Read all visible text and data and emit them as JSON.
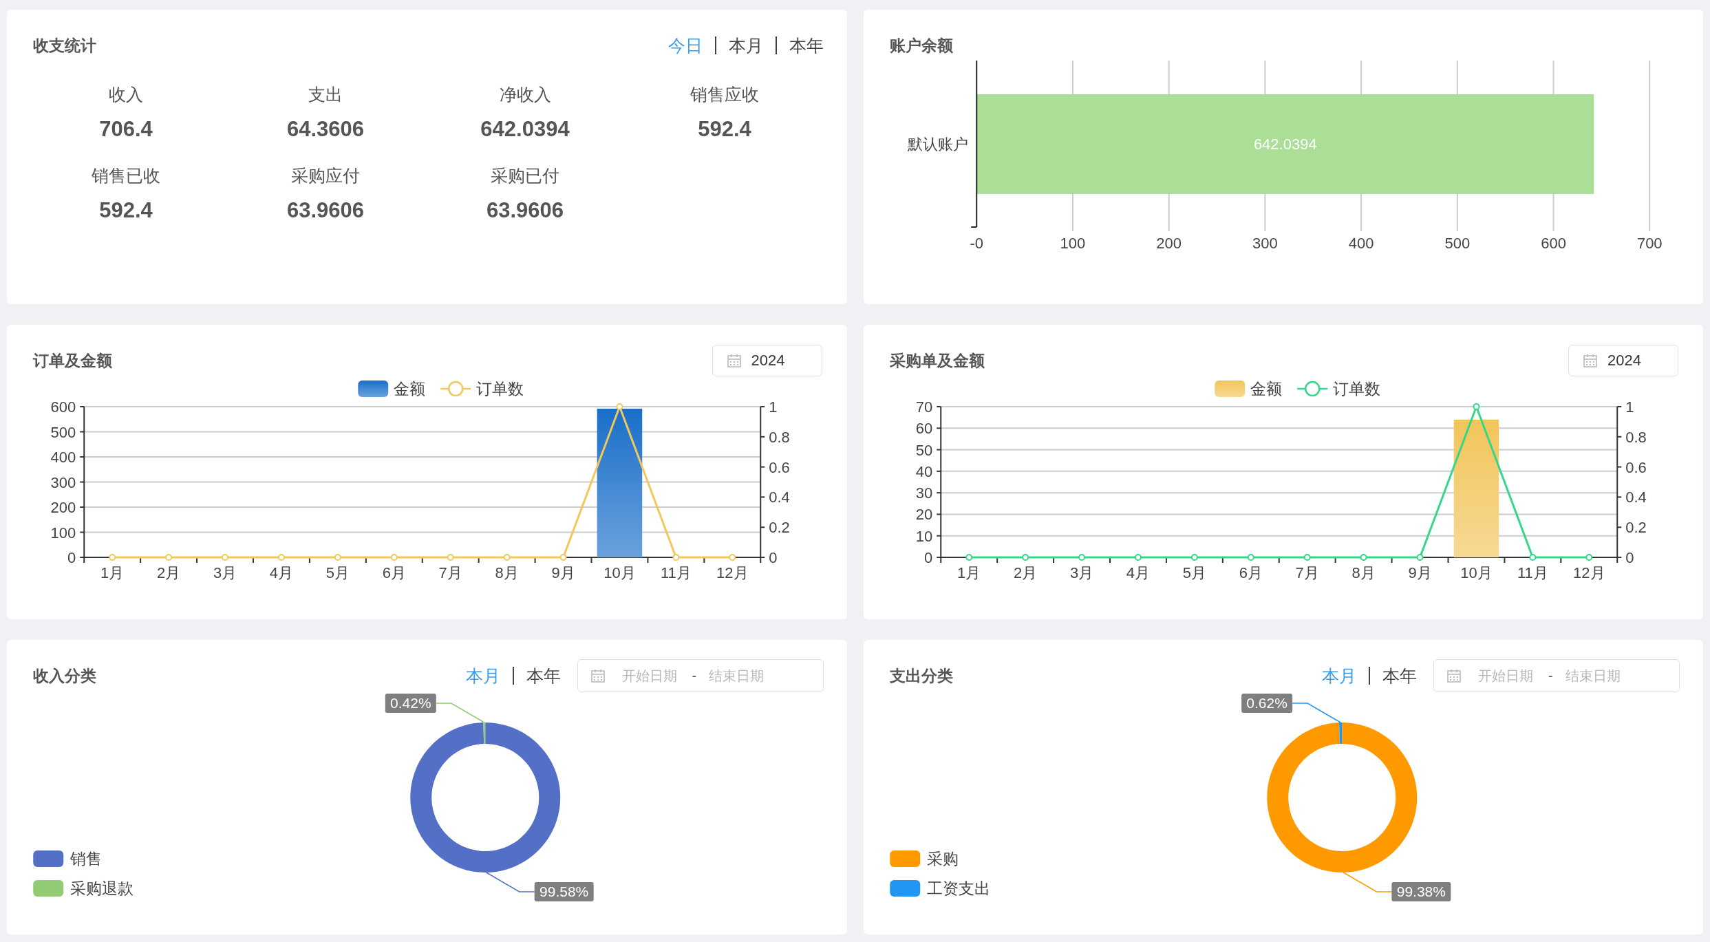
{
  "summary": {
    "title": "收支统计",
    "period_tabs": [
      {
        "label": "今日",
        "selected": true
      },
      {
        "label": "本月",
        "selected": false
      },
      {
        "label": "本年",
        "selected": false
      }
    ],
    "stats": [
      {
        "label": "收入",
        "value": "706.4"
      },
      {
        "label": "支出",
        "value": "64.3606"
      },
      {
        "label": "净收入",
        "value": "642.0394"
      },
      {
        "label": "销售应收",
        "value": "592.4"
      },
      {
        "label": "销售已收",
        "value": "592.4"
      },
      {
        "label": "采购应付",
        "value": "63.9606"
      },
      {
        "label": "采购已付",
        "value": "63.9606"
      }
    ]
  },
  "balance": {
    "title": "账户余额",
    "chart_data": {
      "type": "bar",
      "orientation": "horizontal",
      "categories": [
        "默认账户"
      ],
      "values": [
        642.0394
      ],
      "color": "#abdf97",
      "grid": true,
      "xlim": [
        0,
        700
      ],
      "xticks": [
        {
          "value": 0,
          "label": "-0"
        },
        100,
        200,
        300,
        400,
        500,
        600,
        700
      ],
      "data_labels": true
    }
  },
  "orders": {
    "title": "订单及金额",
    "year_picker": {
      "value": "2024"
    },
    "chart_data": {
      "type": "bar",
      "categories": [
        "1月",
        "2月",
        "3月",
        "4月",
        "5月",
        "6月",
        "7月",
        "8月",
        "9月",
        "10月",
        "11月",
        "12月"
      ],
      "series": [
        {
          "name": "金额",
          "type": "bar",
          "color": "#1a6fc9",
          "values": [
            0,
            0,
            0,
            0,
            0,
            0,
            0,
            0,
            0,
            592,
            0,
            0
          ]
        },
        {
          "name": "订单数",
          "type": "line",
          "axis": "y2",
          "marker": "circle",
          "color": "#f2c75c",
          "values": [
            0,
            0,
            0,
            0,
            0,
            0,
            0,
            0,
            0,
            1,
            0,
            0
          ]
        }
      ],
      "legend": "top",
      "grid": true,
      "ylim": [
        0,
        600
      ],
      "yticks": [
        0,
        100,
        200,
        300,
        400,
        500,
        600
      ],
      "y2lim": [
        0,
        1
      ],
      "y2ticks": [
        0,
        0.2,
        0.4,
        0.6,
        0.8,
        1
      ]
    }
  },
  "purchases": {
    "title": "采购单及金额",
    "year_picker": {
      "value": "2024"
    },
    "chart_data": {
      "type": "bar",
      "categories": [
        "1月",
        "2月",
        "3月",
        "4月",
        "5月",
        "6月",
        "7月",
        "8月",
        "9月",
        "10月",
        "11月",
        "12月"
      ],
      "series": [
        {
          "name": "金额",
          "type": "bar",
          "color": "#f2c55a",
          "values": [
            0,
            0,
            0,
            0,
            0,
            0,
            0,
            0,
            0,
            64,
            0,
            0
          ]
        },
        {
          "name": "订单数",
          "type": "line",
          "axis": "y2",
          "marker": "circle",
          "color": "#36d68a",
          "values": [
            0,
            0,
            0,
            0,
            0,
            0,
            0,
            0,
            0,
            1,
            0,
            0
          ]
        }
      ],
      "legend": "top",
      "grid": true,
      "ylim": [
        0,
        70
      ],
      "yticks": [
        0,
        10,
        20,
        30,
        40,
        50,
        60,
        70
      ],
      "y2lim": [
        0,
        1
      ],
      "y2ticks": [
        0,
        0.2,
        0.4,
        0.6,
        0.8,
        1
      ]
    }
  },
  "income_categories": {
    "title": "收入分类",
    "period_tabs": [
      {
        "label": "本月",
        "selected": true
      },
      {
        "label": "本年",
        "selected": false
      }
    ],
    "date_range": {
      "start_placeholder": "开始日期",
      "separator": "-",
      "end_placeholder": "结束日期"
    },
    "chart_data": {
      "type": "donut",
      "categories": [
        "销售",
        "采购退款"
      ],
      "values": [
        99.58,
        0.42
      ],
      "colors": [
        "#5470c6",
        "#91cc75"
      ],
      "value_labels": [
        "99.58%",
        "0.42%"
      ],
      "legend": "left"
    }
  },
  "expense_categories": {
    "title": "支出分类",
    "period_tabs": [
      {
        "label": "本月",
        "selected": true
      },
      {
        "label": "本年",
        "selected": false
      }
    ],
    "date_range": {
      "start_placeholder": "开始日期",
      "separator": "-",
      "end_placeholder": "结束日期"
    },
    "chart_data": {
      "type": "donut",
      "categories": [
        "采购",
        "工资支出"
      ],
      "values": [
        99.38,
        0.62
      ],
      "colors": [
        "#fe9900",
        "#2196f3"
      ],
      "value_labels": [
        "99.38%",
        "0.62%"
      ],
      "legend": "left"
    }
  }
}
